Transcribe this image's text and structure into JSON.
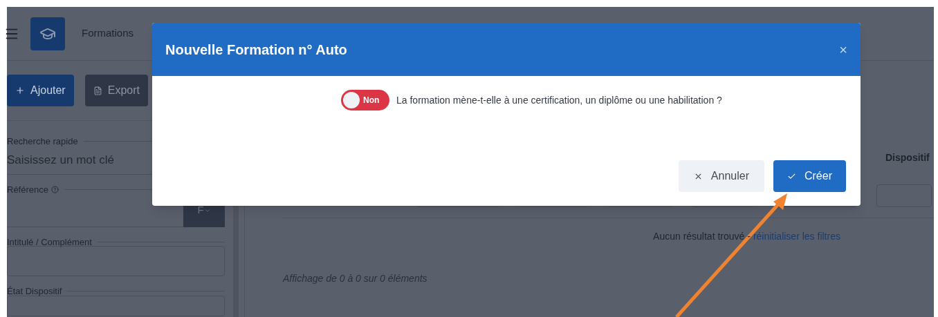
{
  "app_header": {
    "title": "Formations"
  },
  "sidebar": {
    "buttons": [
      {
        "label": "Ajouter",
        "kind": "primary"
      },
      {
        "label": "Export",
        "kind": "secondary"
      }
    ],
    "fields": [
      {
        "label": "Recherche rapide",
        "placeholder": "Saisissez un mot clé",
        "kind": "search"
      },
      {
        "label": "Référence",
        "kind": "reference",
        "addon": "F"
      },
      {
        "label": "Intitulé / Complément",
        "kind": "text"
      },
      {
        "label": "État Dispositif",
        "kind": "select"
      }
    ]
  },
  "table": {
    "columns": [
      "Dispositif"
    ],
    "empty_message": "Aucun résultat trouvé -",
    "reset_link": "réinitialiser les filtres",
    "footer": "Affichage de 0 à 0 sur 0 éléments"
  },
  "modal": {
    "title": "Nouvelle Formation n° Auto",
    "close": "×",
    "toggle": {
      "on": false,
      "label": "Non"
    },
    "question": "La formation mène-t-elle à une certification, un diplôme ou une habilitation ?",
    "buttons": [
      {
        "label": "Annuler",
        "kind": "cancel"
      },
      {
        "label": "Créer",
        "kind": "primary"
      }
    ]
  }
}
